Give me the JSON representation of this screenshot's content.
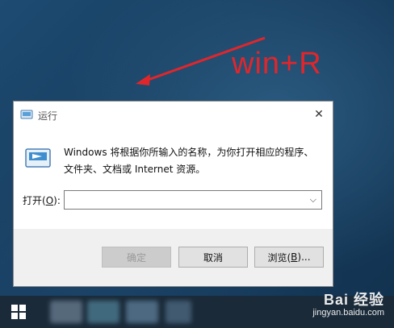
{
  "annotation": {
    "text": "win+R",
    "color": "#e1262b"
  },
  "dialog": {
    "title": "运行",
    "close_glyph": "✕",
    "description": "Windows 将根据你所输入的名称，为你打开相应的程序、文件夹、文档或 Internet 资源。",
    "open_label_prefix": "打开(",
    "open_label_key": "O",
    "open_label_suffix": "):",
    "open_input_value": "",
    "buttons": {
      "ok": "确定",
      "cancel": "取消",
      "browse_prefix": "浏览(",
      "browse_key": "B",
      "browse_suffix": ")..."
    },
    "icons": {
      "title": "run-icon",
      "large": "run-icon",
      "close": "close-icon",
      "dropdown": "chevron-down-icon"
    }
  },
  "taskbar": {
    "start_icon": "windows-logo-icon"
  },
  "watermark": {
    "brand": "Bai 经验",
    "url": "jingyan.baidu.com"
  }
}
